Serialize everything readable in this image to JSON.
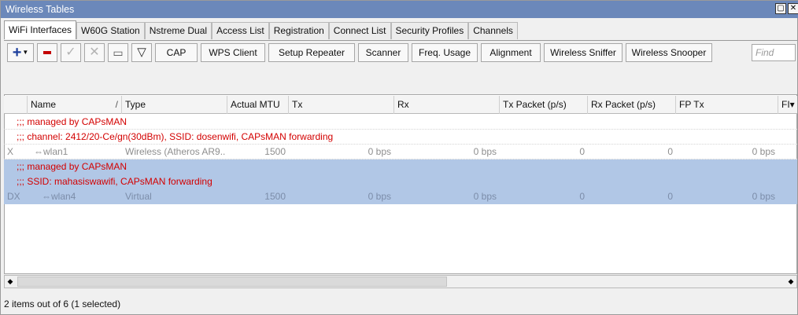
{
  "window": {
    "title": "Wireless Tables",
    "controls": [
      "▢",
      "✕"
    ]
  },
  "tabs": [
    {
      "label": "WiFi Interfaces",
      "active": true
    },
    {
      "label": "W60G Station"
    },
    {
      "label": "Nstreme Dual"
    },
    {
      "label": "Access List"
    },
    {
      "label": "Registration"
    },
    {
      "label": "Connect List"
    },
    {
      "label": "Security Profiles"
    },
    {
      "label": "Channels"
    }
  ],
  "toolbar": {
    "cap": "CAP",
    "wps_client": "WPS Client",
    "setup_repeater": "Setup Repeater",
    "scanner": "Scanner",
    "freq_usage": "Freq. Usage",
    "alignment": "Alignment",
    "wireless_sniffer": "Wireless Sniffer",
    "wireless_snooper": "Wireless Snooper",
    "find_placeholder": "Find"
  },
  "columns": {
    "name": "Name",
    "sort": "/",
    "type": "Type",
    "actual_mtu": "Actual MTU",
    "tx": "Tx",
    "rx": "Rx",
    "tx_packet": "Tx Packet (p/s)",
    "rx_packet": "Rx Packet (p/s)",
    "fp_tx": "FP Tx",
    "fp_rx": "FI▾"
  },
  "rows": [
    {
      "kind": "comment",
      "text": ";;; managed by CAPsMAN"
    },
    {
      "kind": "comment",
      "text": ";;; channel: 2412/20-Ce/gn(30dBm), SSID: dosenwifi, CAPsMAN forwarding"
    },
    {
      "kind": "data",
      "flags": "X",
      "name": "wlan1",
      "type": "Wireless (Atheros AR9...",
      "mtu": "1500",
      "tx": "0 bps",
      "rx": "0 bps",
      "txp": "0",
      "rxp": "0",
      "fptx": "0 bps"
    },
    {
      "kind": "comment",
      "text": ";;; managed by CAPsMAN",
      "selected": true
    },
    {
      "kind": "comment",
      "text": ";;; SSID: mahasiswawifi, CAPsMAN forwarding",
      "selected": true
    },
    {
      "kind": "data",
      "flags": "DX",
      "name": "wlan4",
      "type": "Virtual",
      "mtu": "1500",
      "tx": "0 bps",
      "rx": "0 bps",
      "txp": "0",
      "rxp": "0",
      "fptx": "0 bps",
      "selected": true
    }
  ],
  "status": "2 items out of 6 (1 selected)"
}
